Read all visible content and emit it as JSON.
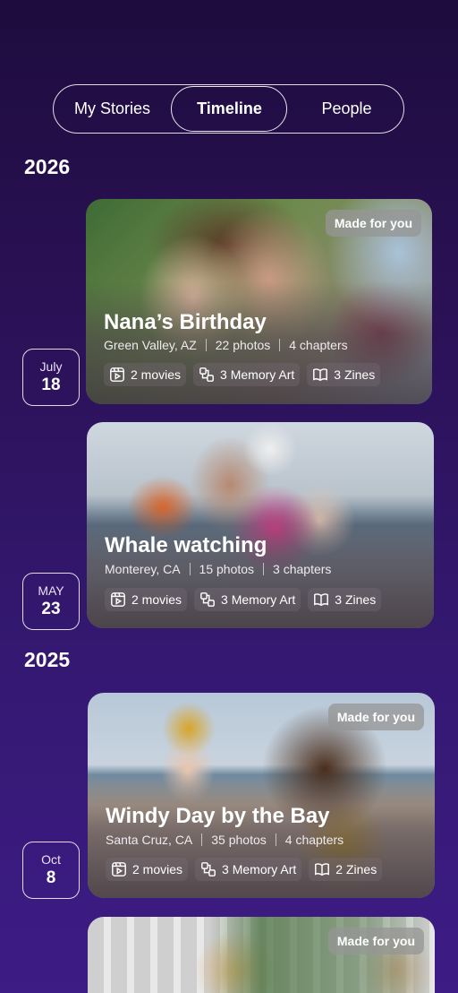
{
  "tabs": {
    "my_stories": "My Stories",
    "timeline": "Timeline",
    "people": "People"
  },
  "years": [
    "2026",
    "2025"
  ],
  "badge_label": "Made for you",
  "stories": [
    {
      "month": "July",
      "day": "18",
      "title": "Nana’s Birthday",
      "location": "Green Valley, AZ",
      "photos": "22 photos",
      "chapters": "4 chapters",
      "movies": "2 movies",
      "memory_art": "3 Memory Art",
      "zines": "3 Zines",
      "made_for_you": true
    },
    {
      "month": "MAY",
      "day": "23",
      "title": "Whale watching",
      "location": "Monterey, CA",
      "photos": "15 photos",
      "chapters": "3 chapters",
      "movies": "2 movies",
      "memory_art": "3 Memory Art",
      "zines": "3 Zines",
      "made_for_you": false
    },
    {
      "month": "Oct",
      "day": "8",
      "title": "Windy Day by the Bay",
      "location": "Santa Cruz, CA",
      "photos": "35 photos",
      "chapters": "4 chapters",
      "movies": "2 movies",
      "memory_art": "3 Memory Art",
      "zines": "2 Zines",
      "made_for_you": true
    },
    {
      "made_for_you": true
    }
  ]
}
